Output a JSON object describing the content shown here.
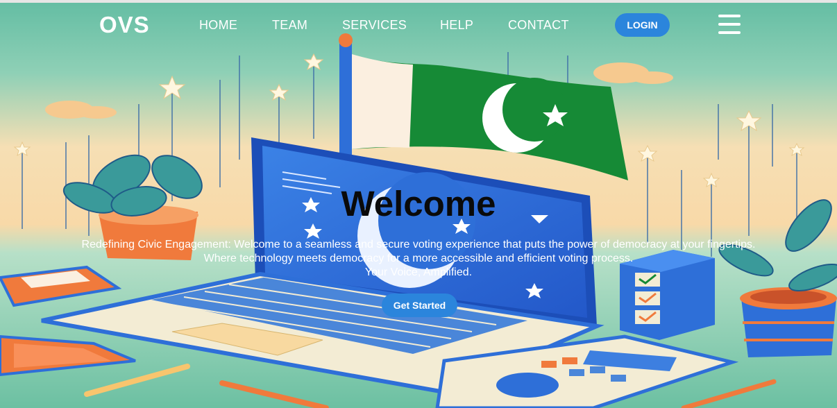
{
  "brand": {
    "name": "OVS"
  },
  "nav": {
    "items": [
      {
        "label": "HOME"
      },
      {
        "label": "TEAM"
      },
      {
        "label": "SERVICES"
      },
      {
        "label": "HELP"
      },
      {
        "label": "CONTACT"
      }
    ],
    "login_label": "LOGIN",
    "menu_icon": "hamburger-menu-icon"
  },
  "hero": {
    "title": "Welcome",
    "line1": "Redefining Civic Engagement: Welcome to a seamless and secure voting experience that puts the power of democracy at your fingertips.",
    "line2": "Where technology meets democracy for a more accessible and efficient voting process.",
    "line3": "Your Voice, Amplified.",
    "cta_label": "Get Started",
    "illustration_icons": [
      "laptop-icon",
      "pakistan-flag-icon",
      "ballot-box-icon",
      "calculator-icon",
      "plant-icon",
      "phone-icon"
    ]
  },
  "colors": {
    "accent": "#2b85dc",
    "teal": "#6fc0a4",
    "peach": "#f8dcae",
    "screen_blue": "#2e6fd8",
    "flag_green": "#168a36",
    "orange": "#f07a3c"
  }
}
